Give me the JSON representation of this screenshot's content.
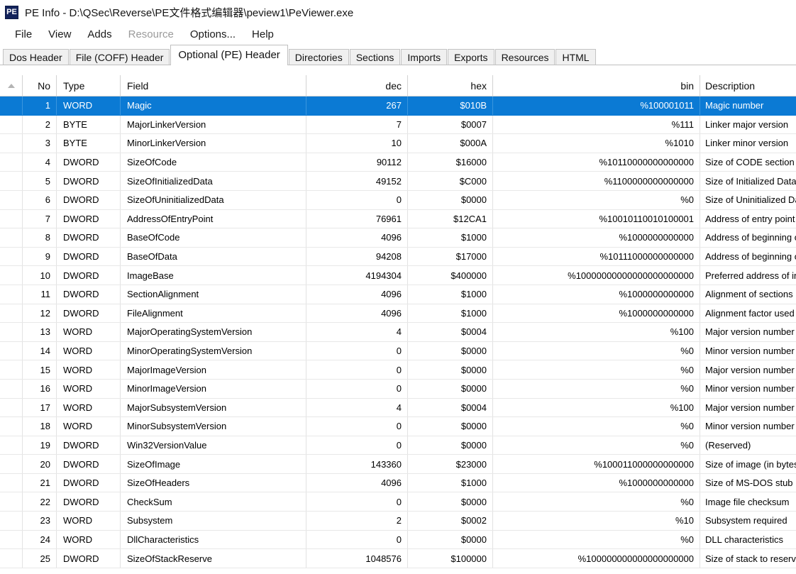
{
  "window": {
    "app_icon_label": "PE",
    "title": "PE Info - D:\\QSec\\Reverse\\PE文件格式编辑器\\peview1\\PeViewer.exe"
  },
  "menubar": {
    "items": [
      {
        "label": "File",
        "disabled": false
      },
      {
        "label": "View",
        "disabled": false
      },
      {
        "label": "Adds",
        "disabled": false
      },
      {
        "label": "Resource",
        "disabled": true
      },
      {
        "label": "Options...",
        "disabled": false
      },
      {
        "label": "Help",
        "disabled": false
      }
    ]
  },
  "tabs": {
    "active_index": 2,
    "items": [
      {
        "label": "Dos Header"
      },
      {
        "label": "File (COFF) Header"
      },
      {
        "label": "Optional (PE) Header"
      },
      {
        "label": "Directories"
      },
      {
        "label": "Sections"
      },
      {
        "label": "Imports"
      },
      {
        "label": "Exports"
      },
      {
        "label": "Resources"
      },
      {
        "label": "HTML"
      }
    ]
  },
  "grid": {
    "sort_indicator": "ascending-sort-icon",
    "selected_row_index": 0,
    "accent_color": "#0b7ad4",
    "columns": [
      {
        "key": "no",
        "label": "No"
      },
      {
        "key": "type",
        "label": "Type"
      },
      {
        "key": "field",
        "label": "Field"
      },
      {
        "key": "dec",
        "label": "dec"
      },
      {
        "key": "hex",
        "label": "hex"
      },
      {
        "key": "bin",
        "label": "bin"
      },
      {
        "key": "desc",
        "label": "Description"
      }
    ],
    "rows": [
      {
        "no": "1",
        "type": "WORD",
        "field": "Magic",
        "dec": "267",
        "hex": "$010B",
        "bin": "%100001011",
        "desc": "Magic number"
      },
      {
        "no": "2",
        "type": "BYTE",
        "field": "MajorLinkerVersion",
        "dec": "7",
        "hex": "$0007",
        "bin": "%111",
        "desc": "Linker major version"
      },
      {
        "no": "3",
        "type": "BYTE",
        "field": "MinorLinkerVersion",
        "dec": "10",
        "hex": "$000A",
        "bin": "%1010",
        "desc": "Linker minor version"
      },
      {
        "no": "4",
        "type": "DWORD",
        "field": "SizeOfCode",
        "dec": "90112",
        "hex": "$16000",
        "bin": "%10110000000000000",
        "desc": "Size of CODE section"
      },
      {
        "no": "5",
        "type": "DWORD",
        "field": "SizeOfInitializedData",
        "dec": "49152",
        "hex": "$C000",
        "bin": "%1100000000000000",
        "desc": "Size of Initialized Data"
      },
      {
        "no": "6",
        "type": "DWORD",
        "field": "SizeOfUninitializedData",
        "dec": "0",
        "hex": "$0000",
        "bin": "%0",
        "desc": "Size of Uninitialized Data"
      },
      {
        "no": "7",
        "type": "DWORD",
        "field": "AddressOfEntryPoint",
        "dec": "76961",
        "hex": "$12CA1",
        "bin": "%10010110010100001",
        "desc": "Address of entry point"
      },
      {
        "no": "8",
        "type": "DWORD",
        "field": "BaseOfCode",
        "dec": "4096",
        "hex": "$1000",
        "bin": "%1000000000000",
        "desc": "Address of beginning of CODE"
      },
      {
        "no": "9",
        "type": "DWORD",
        "field": "BaseOfData",
        "dec": "94208",
        "hex": "$17000",
        "bin": "%10111000000000000",
        "desc": "Address of beginning of DATA"
      },
      {
        "no": "10",
        "type": "DWORD",
        "field": "ImageBase",
        "dec": "4194304",
        "hex": "$400000",
        "bin": "%10000000000000000000000",
        "desc": "Preferred address of image"
      },
      {
        "no": "11",
        "type": "DWORD",
        "field": "SectionAlignment",
        "dec": "4096",
        "hex": "$1000",
        "bin": "%1000000000000",
        "desc": "Alignment of sections"
      },
      {
        "no": "12",
        "type": "DWORD",
        "field": "FileAlignment",
        "dec": "4096",
        "hex": "$1000",
        "bin": "%1000000000000",
        "desc": "Alignment factor used"
      },
      {
        "no": "13",
        "type": "WORD",
        "field": "MajorOperatingSystemVersion",
        "dec": "4",
        "hex": "$0004",
        "bin": "%100",
        "desc": "Major version number"
      },
      {
        "no": "14",
        "type": "WORD",
        "field": "MinorOperatingSystemVersion",
        "dec": "0",
        "hex": "$0000",
        "bin": "%0",
        "desc": "Minor version number"
      },
      {
        "no": "15",
        "type": "WORD",
        "field": "MajorImageVersion",
        "dec": "0",
        "hex": "$0000",
        "bin": "%0",
        "desc": "Major version number"
      },
      {
        "no": "16",
        "type": "WORD",
        "field": "MinorImageVersion",
        "dec": "0",
        "hex": "$0000",
        "bin": "%0",
        "desc": "Minor version number"
      },
      {
        "no": "17",
        "type": "WORD",
        "field": "MajorSubsystemVersion",
        "dec": "4",
        "hex": "$0004",
        "bin": "%100",
        "desc": "Major version number"
      },
      {
        "no": "18",
        "type": "WORD",
        "field": "MinorSubsystemVersion",
        "dec": "0",
        "hex": "$0000",
        "bin": "%0",
        "desc": "Minor version number"
      },
      {
        "no": "19",
        "type": "DWORD",
        "field": "Win32VersionValue",
        "dec": "0",
        "hex": "$0000",
        "bin": "%0",
        "desc": "(Reserved)"
      },
      {
        "no": "20",
        "type": "DWORD",
        "field": "SizeOfImage",
        "dec": "143360",
        "hex": "$23000",
        "bin": "%100011000000000000",
        "desc": "Size of image (in bytes)"
      },
      {
        "no": "21",
        "type": "DWORD",
        "field": "SizeOfHeaders",
        "dec": "4096",
        "hex": "$1000",
        "bin": "%1000000000000",
        "desc": "Size of MS-DOS stub"
      },
      {
        "no": "22",
        "type": "DWORD",
        "field": "CheckSum",
        "dec": "0",
        "hex": "$0000",
        "bin": "%0",
        "desc": "Image file checksum"
      },
      {
        "no": "23",
        "type": "WORD",
        "field": "Subsystem",
        "dec": "2",
        "hex": "$0002",
        "bin": "%10",
        "desc": "Subsystem required"
      },
      {
        "no": "24",
        "type": "WORD",
        "field": "DllCharacteristics",
        "dec": "0",
        "hex": "$0000",
        "bin": "%0",
        "desc": "DLL characteristics"
      },
      {
        "no": "25",
        "type": "DWORD",
        "field": "SizeOfStackReserve",
        "dec": "1048576",
        "hex": "$100000",
        "bin": "%100000000000000000000",
        "desc": "Size of stack to reserve"
      }
    ]
  }
}
